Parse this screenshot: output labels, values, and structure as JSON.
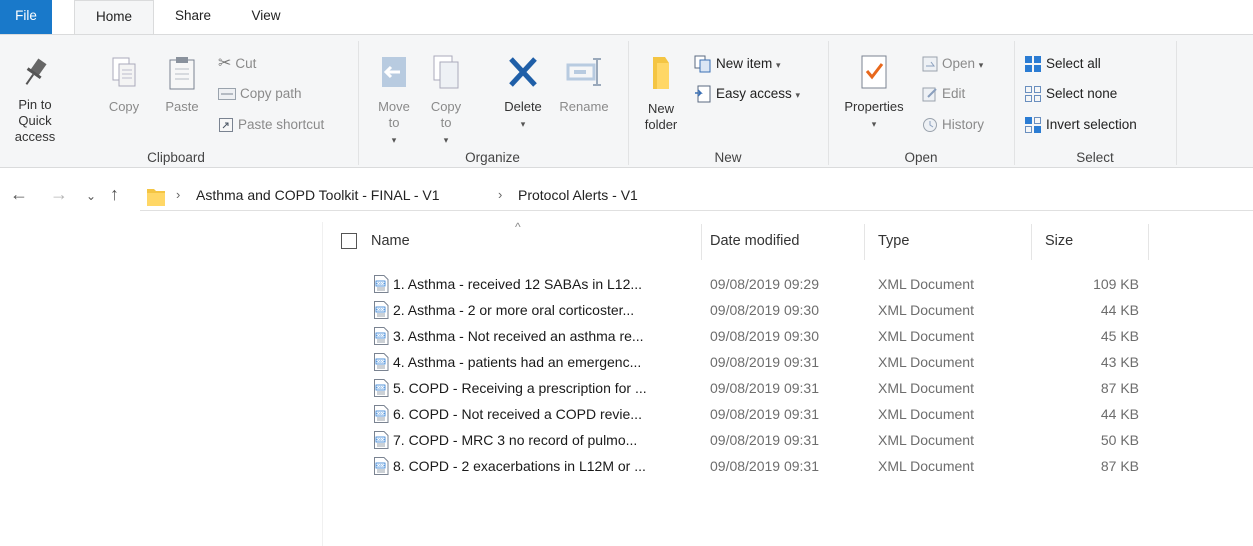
{
  "tabs": [
    "File",
    "Home",
    "Share",
    "View"
  ],
  "clipboard": {
    "pin": "Pin to Quick access",
    "copy": "Copy",
    "paste": "Paste",
    "cut": "Cut",
    "copy_path": "Copy path",
    "paste_shortcut": "Paste shortcut",
    "label": "Clipboard"
  },
  "organize": {
    "move_to": "Move to",
    "copy_to": "Copy to",
    "delete": "Delete",
    "rename": "Rename",
    "label": "Organize"
  },
  "new_group": {
    "new_folder": "New folder",
    "new_item": "New item",
    "easy_access": "Easy access",
    "label": "New"
  },
  "open_group": {
    "properties": "Properties",
    "open": "Open",
    "edit": "Edit",
    "history": "History",
    "label": "Open"
  },
  "select_group": {
    "select_all": "Select all",
    "select_none": "Select none",
    "invert": "Invert selection",
    "label": "Select"
  },
  "breadcrumb": [
    "Asthma and COPD Toolkit  - FINAL - V1",
    "Protocol Alerts - V1"
  ],
  "columns": {
    "name": "Name",
    "date": "Date modified",
    "type": "Type",
    "size": "Size"
  },
  "files": [
    {
      "name": "1. Asthma - received  12 SABAs in L12...",
      "date": "09/08/2019 09:29",
      "type": "XML Document",
      "size": "109 KB"
    },
    {
      "name": "2. Asthma - 2 or more oral corticoster...",
      "date": "09/08/2019 09:30",
      "type": "XML Document",
      "size": "44 KB"
    },
    {
      "name": "3. Asthma - Not received an asthma re...",
      "date": "09/08/2019 09:30",
      "type": "XML Document",
      "size": "45 KB"
    },
    {
      "name": "4. Asthma - patients had an emergenc...",
      "date": "09/08/2019 09:31",
      "type": "XML Document",
      "size": "43 KB"
    },
    {
      "name": "5. COPD - Receiving a prescription for ...",
      "date": "09/08/2019 09:31",
      "type": "XML Document",
      "size": "87 KB"
    },
    {
      "name": "6. COPD - Not received a COPD revie...",
      "date": "09/08/2019 09:31",
      "type": "XML Document",
      "size": "44 KB"
    },
    {
      "name": "7. COPD - MRC 3 no record of pulmo...",
      "date": "09/08/2019 09:31",
      "type": "XML Document",
      "size": "50 KB"
    },
    {
      "name": "8. COPD - 2 exacerbations in L12M or ...",
      "date": "09/08/2019 09:31",
      "type": "XML Document",
      "size": "87 KB"
    }
  ]
}
